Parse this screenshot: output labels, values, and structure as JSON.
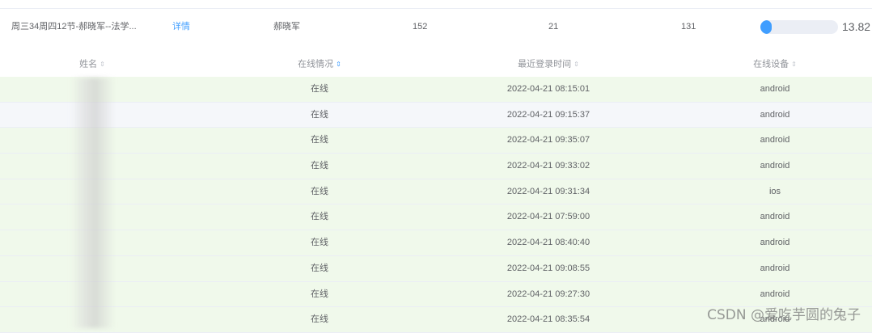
{
  "summary": {
    "course": "周三34周四12节-郝晓军--法学...",
    "detail_link": "详情",
    "teacher": "郝晓军",
    "total": "152",
    "online": "21",
    "offline": "131",
    "online_rate": "13.82",
    "online_rate_fraction": 0.1382
  },
  "table": {
    "headers": {
      "name": "姓名",
      "status": "在线情况",
      "last_login": "最近登录时间",
      "device": "在线设备"
    },
    "rows": [
      {
        "status": "在线",
        "time": "2022-04-21 08:15:01",
        "device": "android"
      },
      {
        "status": "在线",
        "time": "2022-04-21 09:15:37",
        "device": "android"
      },
      {
        "status": "在线",
        "time": "2022-04-21 09:35:07",
        "device": "android"
      },
      {
        "status": "在线",
        "time": "2022-04-21 09:33:02",
        "device": "android"
      },
      {
        "status": "在线",
        "time": "2022-04-21 09:31:34",
        "device": "ios"
      },
      {
        "status": "在线",
        "time": "2022-04-21 07:59:00",
        "device": "android"
      },
      {
        "status": "在线",
        "time": "2022-04-21 08:40:40",
        "device": "android"
      },
      {
        "status": "在线",
        "time": "2022-04-21 09:08:55",
        "device": "android"
      },
      {
        "status": "在线",
        "time": "2022-04-21 09:27:30",
        "device": "android"
      },
      {
        "status": "在线",
        "time": "2022-04-21 08:35:54",
        "device": "android"
      }
    ]
  },
  "watermark": "CSDN @爱吃芋圆的兔子",
  "colors": {
    "accent": "#409eff",
    "row_highlight": "#f0f9eb",
    "row_hover": "#f5f7fa"
  }
}
